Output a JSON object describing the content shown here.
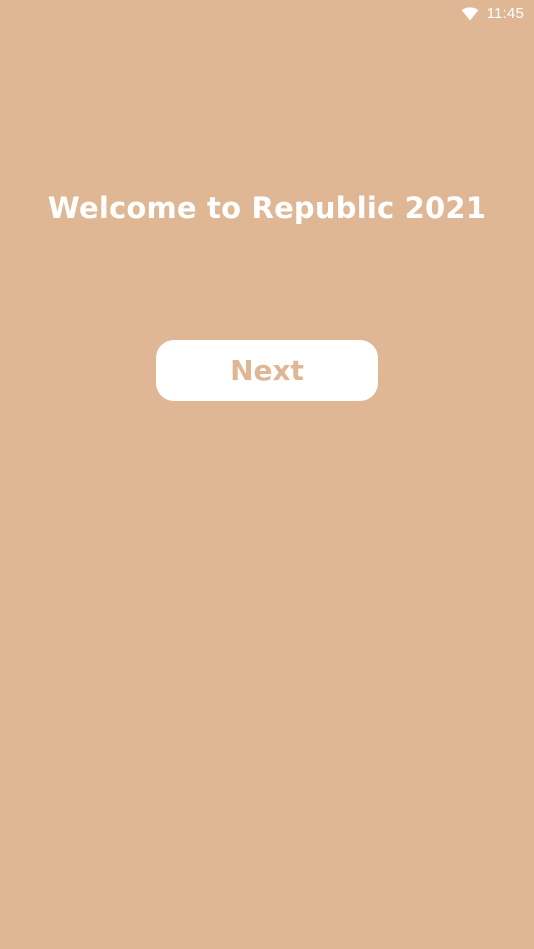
{
  "status_bar": {
    "time": "11:45",
    "icons": [
      "wifi-icon"
    ]
  },
  "main": {
    "title": "Welcome to Republic 2021",
    "next_label": "Next"
  },
  "colors": {
    "background": "#DFB794",
    "button_background": "#FFFFFF",
    "button_text": "#DFB794",
    "title_text": "#FFFFFF"
  }
}
